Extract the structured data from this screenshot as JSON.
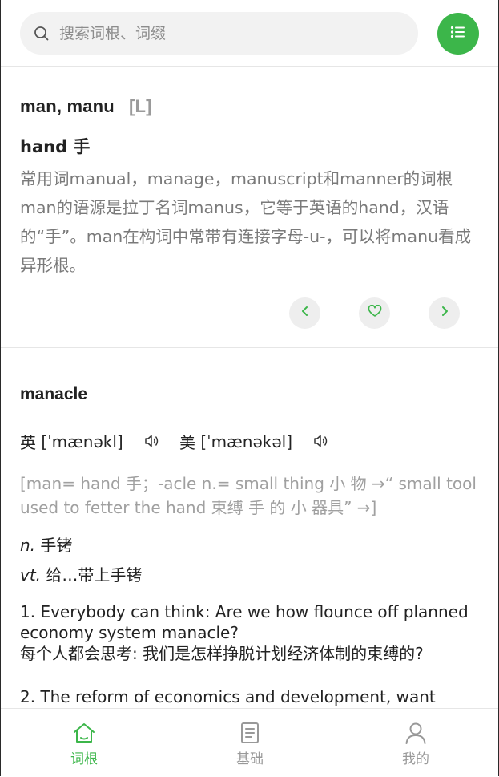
{
  "search": {
    "placeholder": "搜索词根、词缀",
    "icon": "search-icon"
  },
  "menu_button": {
    "icon": "list-icon",
    "color": "#3cb64a"
  },
  "root_card": {
    "title": "man, manu",
    "tag": "[L]",
    "meaning": "hand 手",
    "description": "常用词manual，manage，manuscript和manner的词根man的语源是拉丁名词manus，它等于英语的hand，汉语的“手”。man在构词中常带有连接字母-u-，可以将manu看成异形根。",
    "actions": [
      {
        "name": "previous",
        "icon": "chevron-left-icon"
      },
      {
        "name": "favorite",
        "icon": "heart-icon"
      },
      {
        "name": "next",
        "icon": "chevron-right-icon"
      }
    ]
  },
  "word_card": {
    "word": "manacle",
    "uk": {
      "label": "英",
      "phonetic": "[ˈmænəkl]",
      "icon": "speaker-icon"
    },
    "us": {
      "label": "美",
      "phonetic": "[ˈmænəkəl]",
      "icon": "speaker-icon"
    },
    "etymology": "[man= hand 手；-acle n.= small thing 小 物 →“ small tool used to fetter the hand 束缚 手 的 小 器具” →]",
    "definitions": [
      {
        "pos": "n.",
        "meaning": "手铐"
      },
      {
        "pos": "vt.",
        "meaning": "给…带上手铐"
      }
    ],
    "examples": [
      {
        "en": "1. Everybody can think: Are we how flounce off planned economy system manacle?",
        "zh": "每个人都会思考: 我们是怎样挣脱计划经济体制的束缚的?"
      },
      {
        "en": "2. The reform of economics and development, want",
        "zh": ""
      }
    ]
  },
  "tabbar": {
    "active_color": "#3cb64a",
    "inactive_color": "#999999",
    "tabs": [
      {
        "label": "词根",
        "icon": "home-icon",
        "active": true
      },
      {
        "label": "基础",
        "icon": "book-icon",
        "active": false
      },
      {
        "label": "我的",
        "icon": "user-icon",
        "active": false
      }
    ]
  }
}
